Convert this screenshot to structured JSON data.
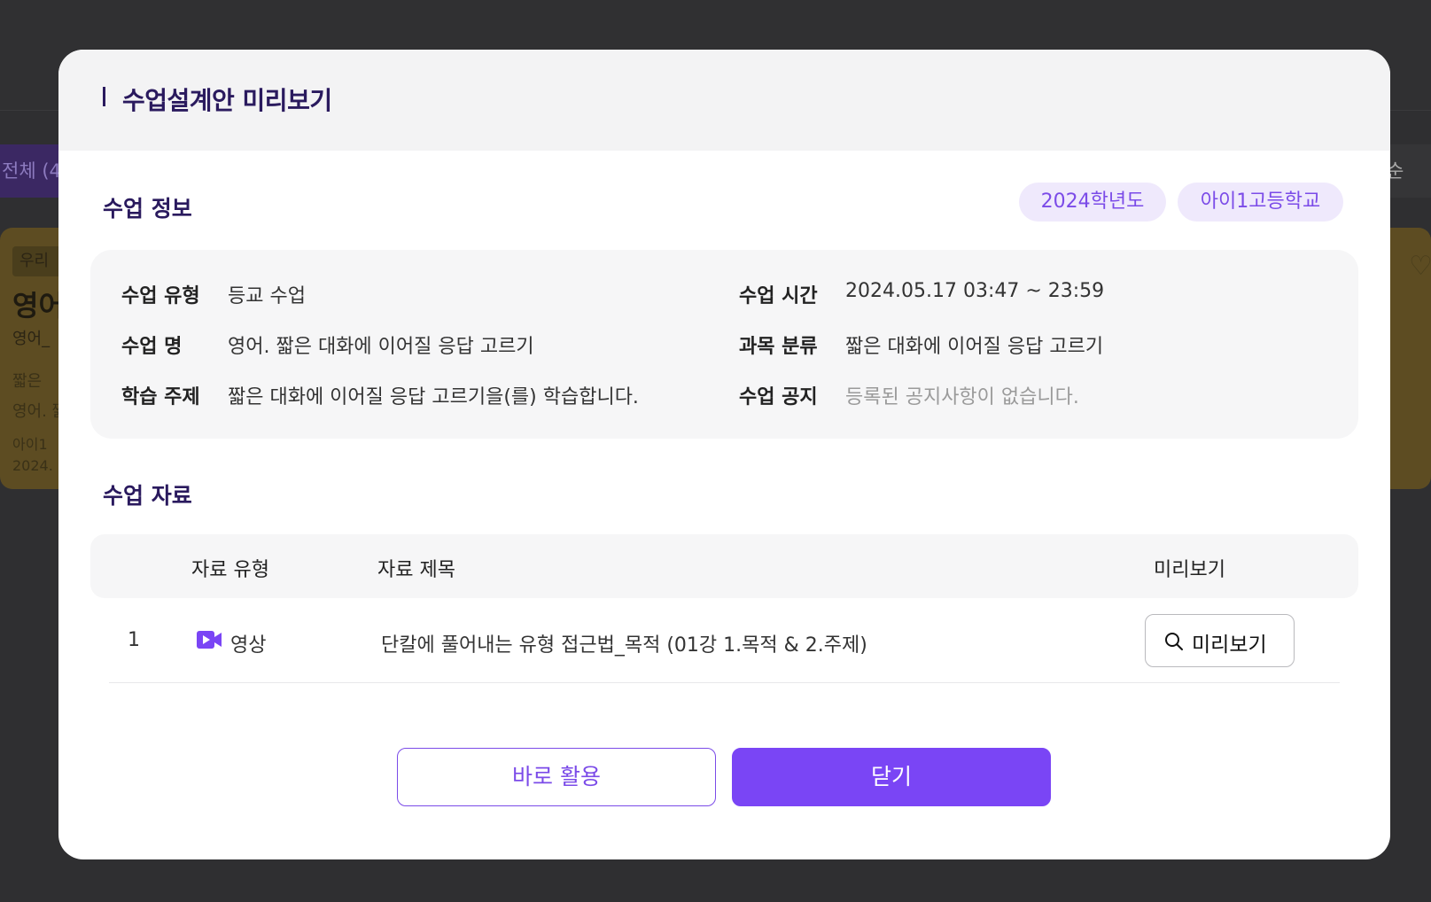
{
  "background": {
    "tab_label": "전체 (4",
    "sort_label": "순",
    "card": {
      "badge": "우리 학",
      "title": "영어",
      "subtitle": "영어_",
      "line1": "짧은",
      "line2": "영어. 짧",
      "line3": "아이1",
      "line4": "2024."
    }
  },
  "modal": {
    "title": "수업설계안 미리보기",
    "info_section": {
      "title": "수업 정보",
      "tags": [
        "2024학년도",
        "아이1고등학교"
      ],
      "fields": {
        "type_label": "수업 유형",
        "type_value": "등교 수업",
        "name_label": "수업 명",
        "name_value": "영어. 짧은 대화에 이어질 응답 고르기",
        "topic_label": "학습 주제",
        "topic_value": "짧은 대화에 이어질 응답 고르기을(를) 학습합니다.",
        "time_label": "수업 시간",
        "time_value": "2024.05.17 03:47 ~ 23:59",
        "category_label": "과목 분류",
        "category_value": "짧은 대화에 이어질 응답 고르기",
        "notice_label": "수업 공지",
        "notice_value": "등록된 공지사항이 없습니다."
      }
    },
    "materials_section": {
      "title": "수업 자료",
      "columns": {
        "type": "자료 유형",
        "title": "자료 제목",
        "preview": "미리보기"
      },
      "rows": [
        {
          "index": "1",
          "type": "영상",
          "type_icon": "video-icon",
          "title": "단칼에 풀어내는 유형 접근법_목적 (01강 1.목적 & 2.주제)",
          "preview_label": "미리보기"
        }
      ]
    },
    "buttons": {
      "use_now": "바로 활용",
      "close": "닫기"
    },
    "colors": {
      "accent": "#7a45f5",
      "title": "#2a1a5e",
      "tag_bg": "#efe9fc"
    }
  }
}
